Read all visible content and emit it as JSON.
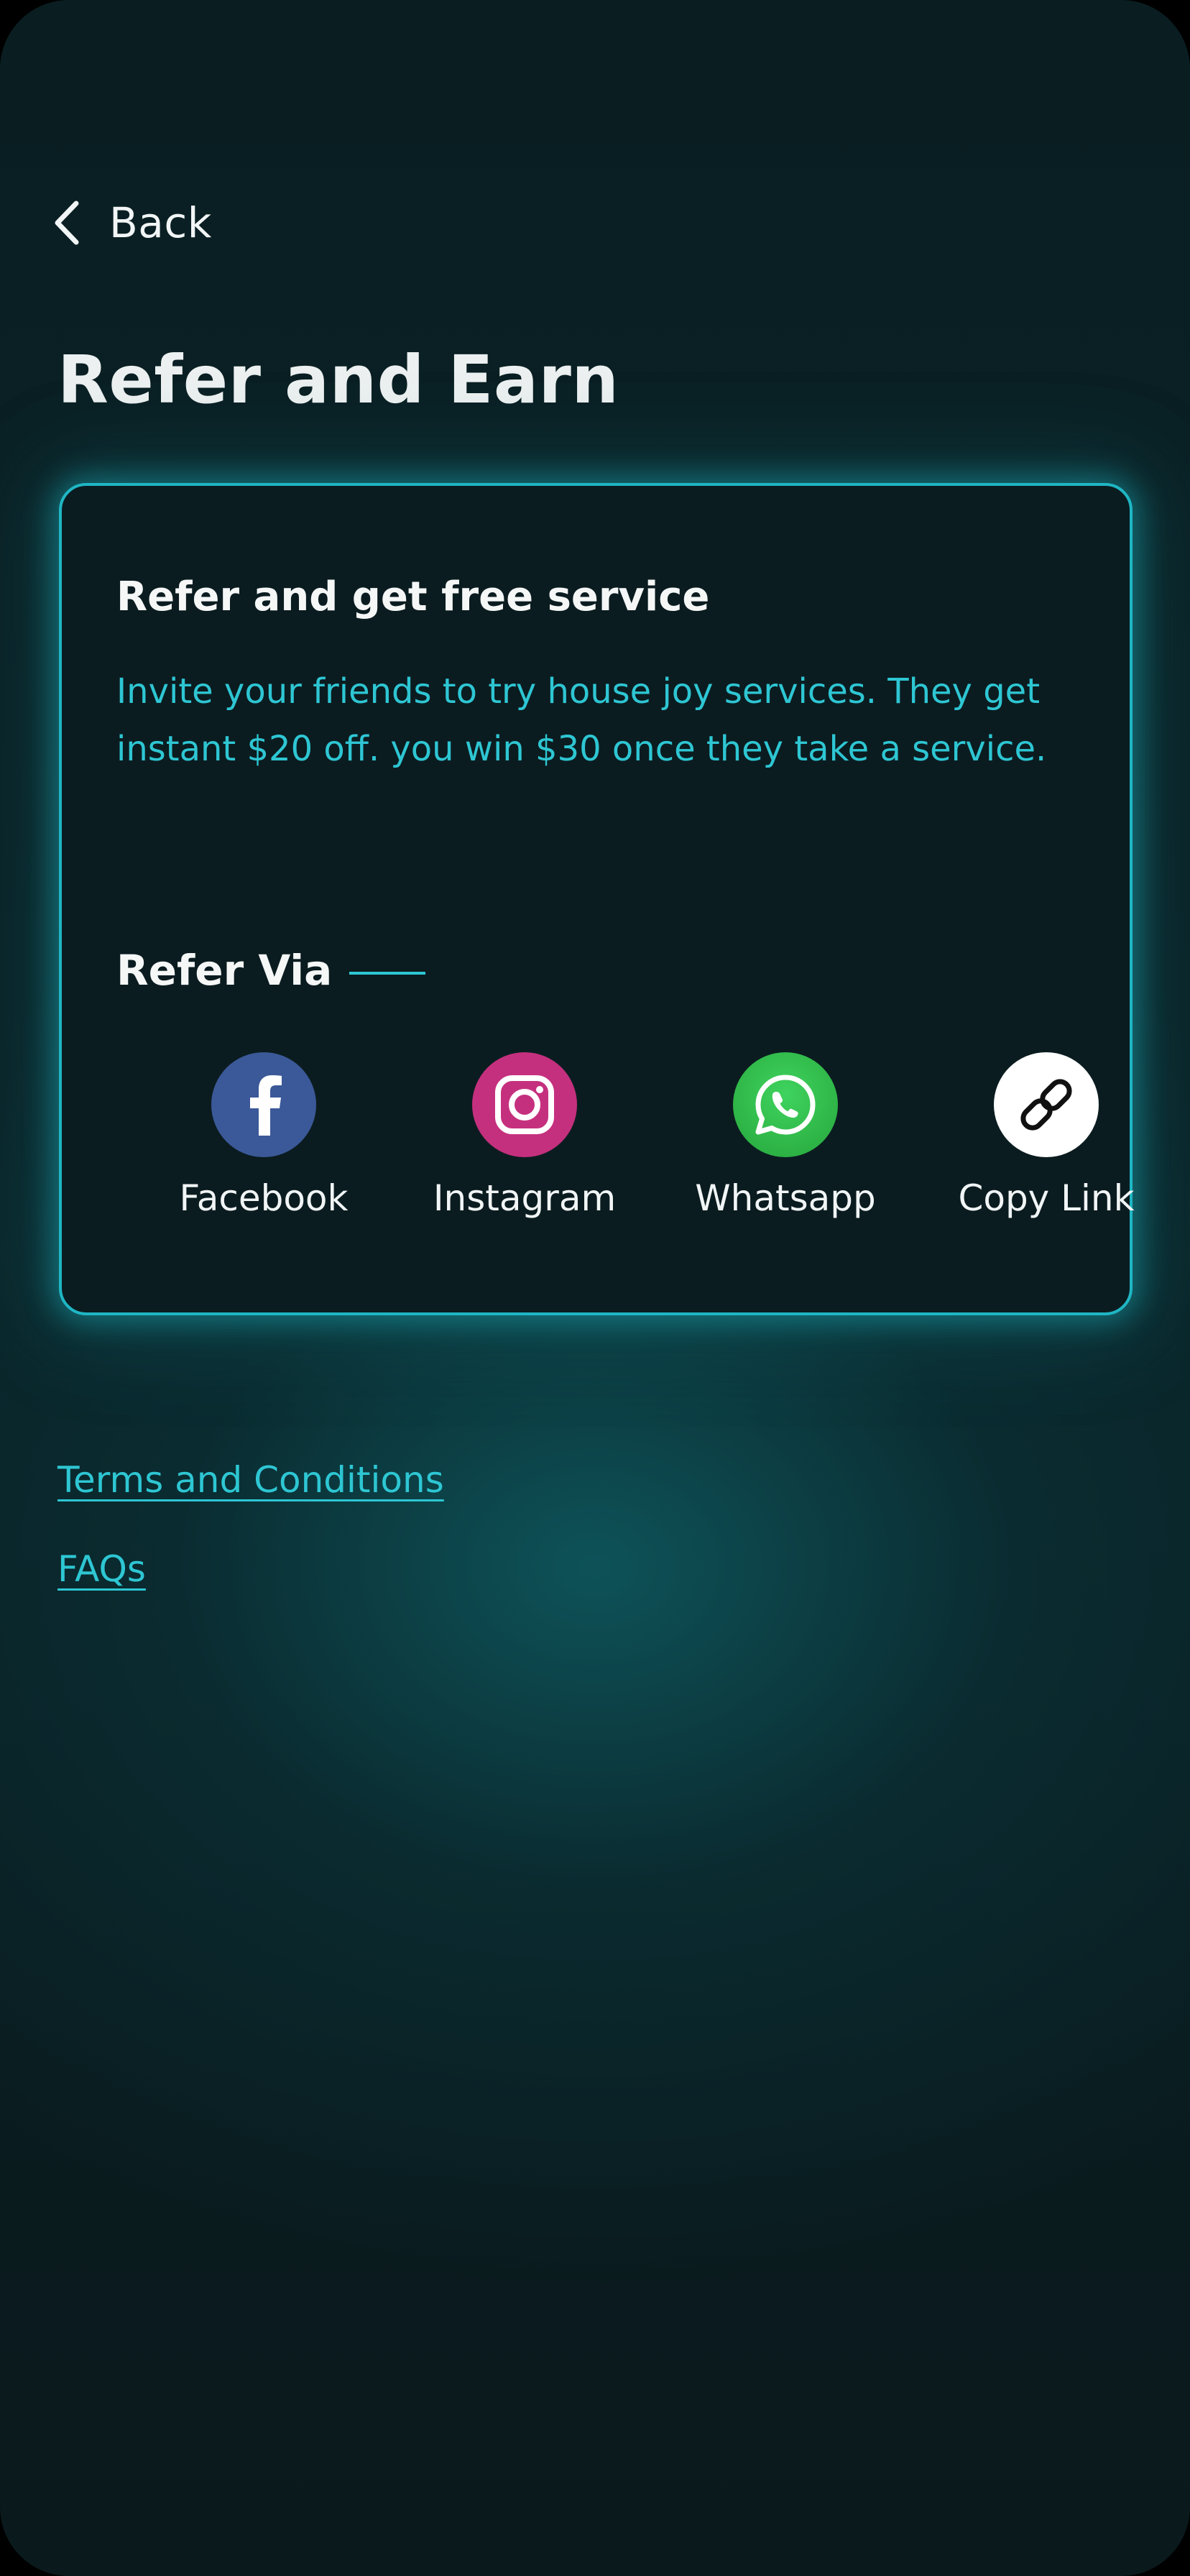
{
  "header": {
    "back_label": "Back",
    "title": "Refer and Earn"
  },
  "card": {
    "title": "Refer and get free service",
    "description": "Invite your friends to try house joy services. They get instant $20 off. you win $30 once they take a service.",
    "refer_via_label": "Refer Via",
    "share_options": [
      {
        "label": "Facebook",
        "icon": "facebook-icon",
        "color": "#3b5998"
      },
      {
        "label": "Instagram",
        "icon": "instagram-icon",
        "color": "#c5307e"
      },
      {
        "label": "Whatsapp",
        "icon": "whatsapp-icon",
        "color": "#2fbe4a"
      },
      {
        "label": "Copy Link",
        "icon": "link-icon",
        "color": "#ffffff"
      }
    ]
  },
  "links": {
    "terms": "Terms and Conditions",
    "faqs": "FAQs"
  },
  "colors": {
    "accent": "#2ec6d3",
    "card_border": "#1fb6c4",
    "background": "#0a1e22"
  }
}
